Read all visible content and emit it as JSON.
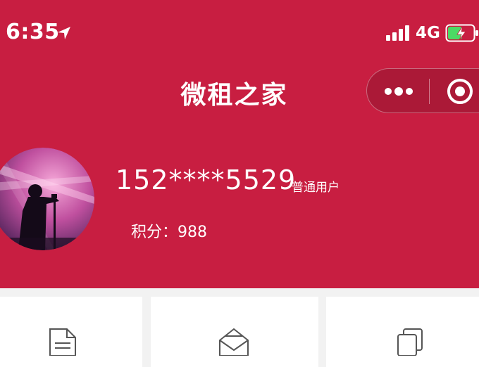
{
  "status_bar": {
    "time": "6:35",
    "network": "4G",
    "icons": [
      "location-arrow-icon",
      "signal-bars-icon",
      "battery-charging-icon"
    ]
  },
  "nav": {
    "title": "微租之家",
    "capsule_icons": [
      "more-dots-icon",
      "target-icon"
    ]
  },
  "profile": {
    "phone": "152****5529",
    "user_type": "普通用户",
    "points_text": "积分：988"
  },
  "cards": [
    {
      "icon": "document-icon"
    },
    {
      "icon": "open-envelope-icon"
    },
    {
      "icon": "copy-icon"
    }
  ],
  "colors": {
    "brand_red": "#c81e41",
    "background": "#f2f2f2",
    "card": "#ffffff",
    "battery_green": "#4cd964"
  }
}
